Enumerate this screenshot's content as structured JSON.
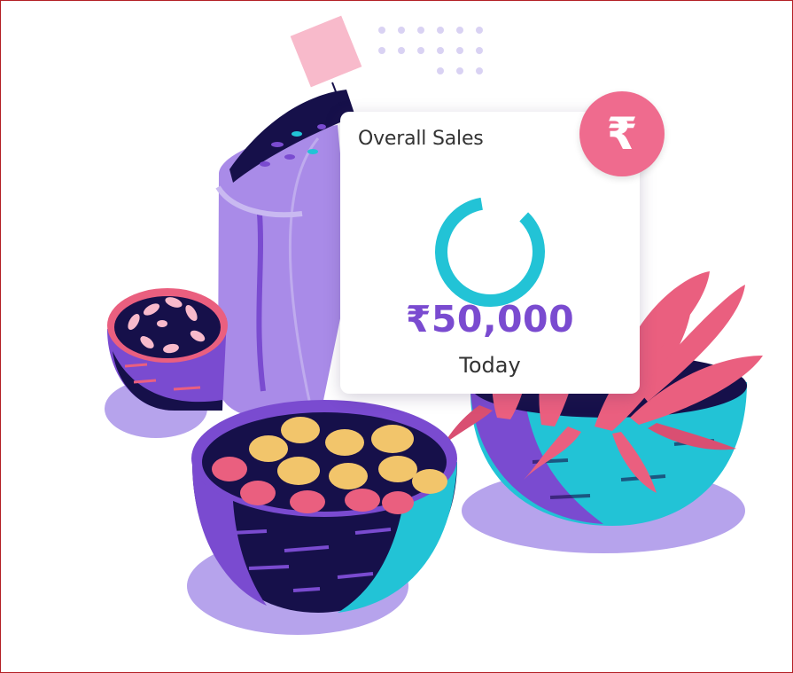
{
  "card": {
    "title": "Overall Sales",
    "amount": "₹50,000",
    "period": "Today",
    "progress_fraction": 0.85
  },
  "badge": {
    "icon": "rupee-icon",
    "symbol": "₹"
  },
  "colors": {
    "amount": "#7a4bd0",
    "ring": "#22c3d6",
    "badge": "#ef6b8e",
    "frame_border": "#b32025",
    "purple_light": "#a98be8",
    "purple_dark": "#16104a",
    "pink": "#ea5f7f"
  }
}
